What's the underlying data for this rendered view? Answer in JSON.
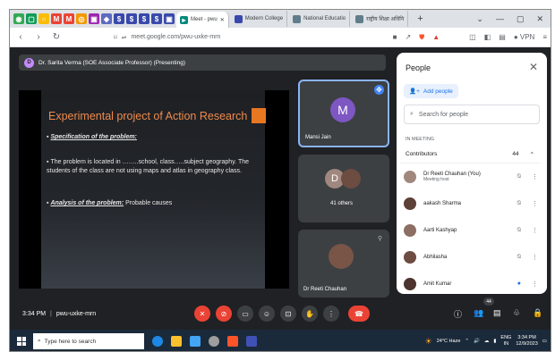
{
  "browser": {
    "tabs": [
      {
        "label": "Meet - pwu",
        "active": true
      },
      {
        "label": "Modern College",
        "active": false
      },
      {
        "label": "National Educatio",
        "active": false
      },
      {
        "label": "राष्ट्रीय शिक्षा अधिनि",
        "active": false
      }
    ],
    "url": "meet.google.com/pwu-uxke-mrn",
    "vpn_label": "VPN"
  },
  "meet": {
    "presenter_initial": "D",
    "presenter": "Dr. Sarita Verma (SOE Associate Professor) (Presenting)",
    "slide": {
      "title": "Experimental project of Action Research",
      "heading1": "Specification of the problem:",
      "body": "The problem is located in ……..school, class…..subject geography. The students of the class are not using maps and atlas in geography class.",
      "heading2": "Analysis of the problem:",
      "heading2_rest": " Probable causes"
    },
    "tiles": {
      "pinned_initial": "M",
      "pinned_name": "Mansi Jain",
      "others_initial": "D",
      "others_label": "41 others",
      "host_name": "Dr Reeti Chauhan"
    },
    "time": "3:34 PM",
    "code": "pwu-uxke-mrn",
    "people_badge": "44"
  },
  "people_panel": {
    "title": "People",
    "add_label": "Add people",
    "search_placeholder": "Search for people",
    "section": "IN MEETING",
    "contributors_label": "Contributors",
    "contributors_count": "44",
    "members": [
      {
        "name": "Dr Reeti Chauhan (You)",
        "sub": "Meeting host"
      },
      {
        "name": "aakash Sharma",
        "sub": ""
      },
      {
        "name": "Aarti Kashyap",
        "sub": ""
      },
      {
        "name": "Abhilasha",
        "sub": ""
      },
      {
        "name": "Amit Kumar",
        "sub": ""
      }
    ]
  },
  "taskbar": {
    "search_placeholder": "Type here to search",
    "weather": "24°C  Haze",
    "lang": "ENG",
    "region": "IN",
    "time": "3:34 PM",
    "date": "12/9/2023"
  }
}
